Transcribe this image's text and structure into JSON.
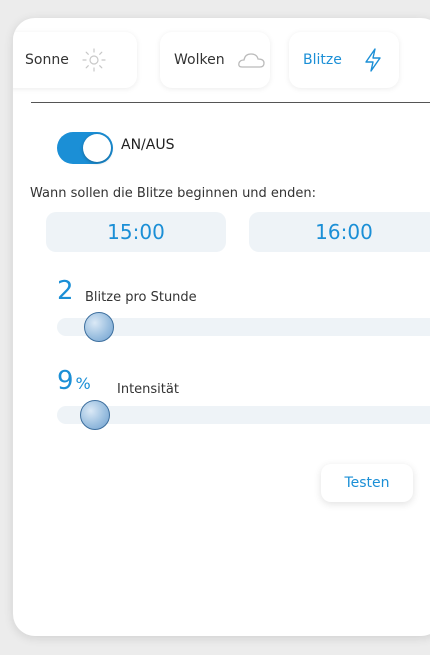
{
  "tabs": [
    {
      "label": "Sonne",
      "icon": "sun-icon"
    },
    {
      "label": "Wolken",
      "icon": "cloud-icon"
    },
    {
      "label": "Blitze",
      "icon": "lightning-icon",
      "active": true
    }
  ],
  "toggle": {
    "label": "AN/AUS",
    "on": true
  },
  "schedule": {
    "question": "Wann sollen die Blitze beginnen und enden:",
    "start": "15:00",
    "end": "16:00"
  },
  "frequency": {
    "value": "2",
    "label": "Blitze pro Stunde",
    "slider_fraction": 0.11
  },
  "intensity": {
    "value": "9",
    "unit": "%",
    "label": "Intensität",
    "slider_fraction": 0.09
  },
  "test_button": {
    "label": "Testen"
  },
  "colors": {
    "accent": "#1b8fd6",
    "field_bg": "#eef3f7"
  }
}
